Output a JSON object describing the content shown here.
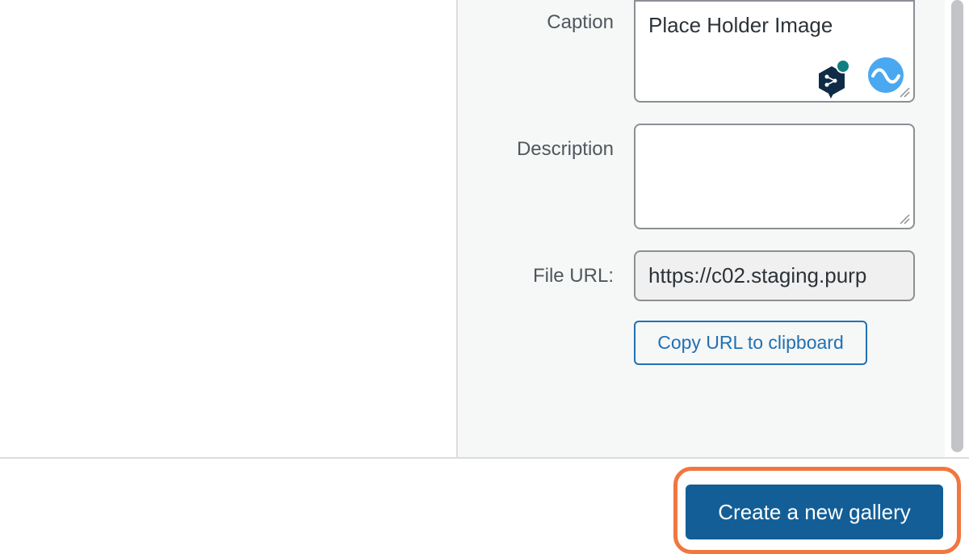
{
  "attachment_details": {
    "caption": {
      "label": "Caption",
      "value": "Place Holder Image"
    },
    "description": {
      "label": "Description",
      "value": ""
    },
    "file_url": {
      "label": "File URL:",
      "value": "https://c02.staging.purp"
    },
    "copy_url_button": "Copy URL to clipboard"
  },
  "extensions": {
    "icons": [
      "deepl-icon",
      "languagetool-icon"
    ],
    "colors": {
      "deepl": "#0f2b46",
      "deepl_dot": "#0f7f7f",
      "languagetool": "#4aa8f0"
    }
  },
  "toolbar": {
    "primary_button": "Create a new gallery",
    "highlight_color": "#f2763f"
  },
  "colors": {
    "accent": "#2271b1",
    "primary": "#135e96",
    "pane_background": "#f6f7f7"
  }
}
